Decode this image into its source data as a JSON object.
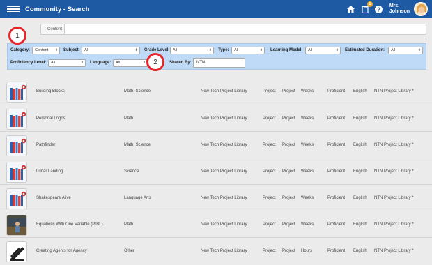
{
  "header": {
    "title": "Community - Search",
    "notification_count": "1",
    "user_name_line1": "Mrs.",
    "user_name_line2": "Johnson",
    "brand_color": "#1d5aa3"
  },
  "search": {
    "content_tab_label": "Content",
    "content_value": ""
  },
  "filters": {
    "category": {
      "label": "Category:",
      "value": "Content"
    },
    "subject": {
      "label": "Subject:",
      "value": "All"
    },
    "grade_level": {
      "label": "Grade Level:",
      "value": "All"
    },
    "type": {
      "label": "Type:",
      "value": "All"
    },
    "learning_model": {
      "label": "Learning Model:",
      "value": "All"
    },
    "estimated_duration": {
      "label": "Estimated Duration:",
      "value": "All"
    },
    "proficiency_level": {
      "label": "Proficiency Level:",
      "value": "All"
    },
    "language": {
      "label": "Language:",
      "value": "All"
    },
    "shared_by": {
      "label": "Shared By:",
      "value": "NTN"
    },
    "bar_color": "#bfdaf6"
  },
  "steps": [
    "1",
    "2"
  ],
  "results": [
    {
      "thumb": "books-icon",
      "name": "Building Blocks",
      "subject": "Math, Science",
      "library": "New Tech Project Library",
      "type": "Project",
      "model": "Project",
      "duration": "Weeks",
      "proficiency": "Proficient",
      "language": "English",
      "shared_by": "NTN Project Library *"
    },
    {
      "thumb": "books-icon",
      "name": "Personal Logos",
      "subject": "Math",
      "library": "New Tech Project Library",
      "type": "Project",
      "model": "Project",
      "duration": "Weeks",
      "proficiency": "Proficient",
      "language": "English",
      "shared_by": "NTN Project Library *"
    },
    {
      "thumb": "books-icon",
      "name": "Pathfinder",
      "subject": "Math, Science",
      "library": "New Tech Project Library",
      "type": "Project",
      "model": "Project",
      "duration": "Weeks",
      "proficiency": "Proficient",
      "language": "English",
      "shared_by": "NTN Project Library *"
    },
    {
      "thumb": "books-icon",
      "name": "Lunar Landing",
      "subject": "Science",
      "library": "New Tech Project Library",
      "type": "Project",
      "model": "Project",
      "duration": "Weeks",
      "proficiency": "Proficient",
      "language": "English",
      "shared_by": "NTN Project Library *"
    },
    {
      "thumb": "books-icon",
      "name": "Shakespeare Alive",
      "subject": "Language Arts",
      "library": "New Tech Project Library",
      "type": "Project",
      "model": "Project",
      "duration": "Weeks",
      "proficiency": "Proficient",
      "language": "English",
      "shared_by": "NTN Project Library *"
    },
    {
      "thumb": "photo-thumbnail",
      "name": "Equations With One Variable (PrBL)",
      "subject": "Math",
      "library": "New Tech Project Library",
      "type": "Project",
      "model": "Project",
      "duration": "Weeks",
      "proficiency": "Proficient",
      "language": "English",
      "shared_by": "NTN Project Library *"
    },
    {
      "thumb": "agency-logo-icon",
      "name": "Creating Agents for Agency",
      "subject": "Other",
      "library": "New Tech Project Library",
      "type": "Project",
      "model": "Project",
      "duration": "Hours",
      "proficiency": "Proficient",
      "language": "English",
      "shared_by": "NTN Project Library *"
    }
  ]
}
